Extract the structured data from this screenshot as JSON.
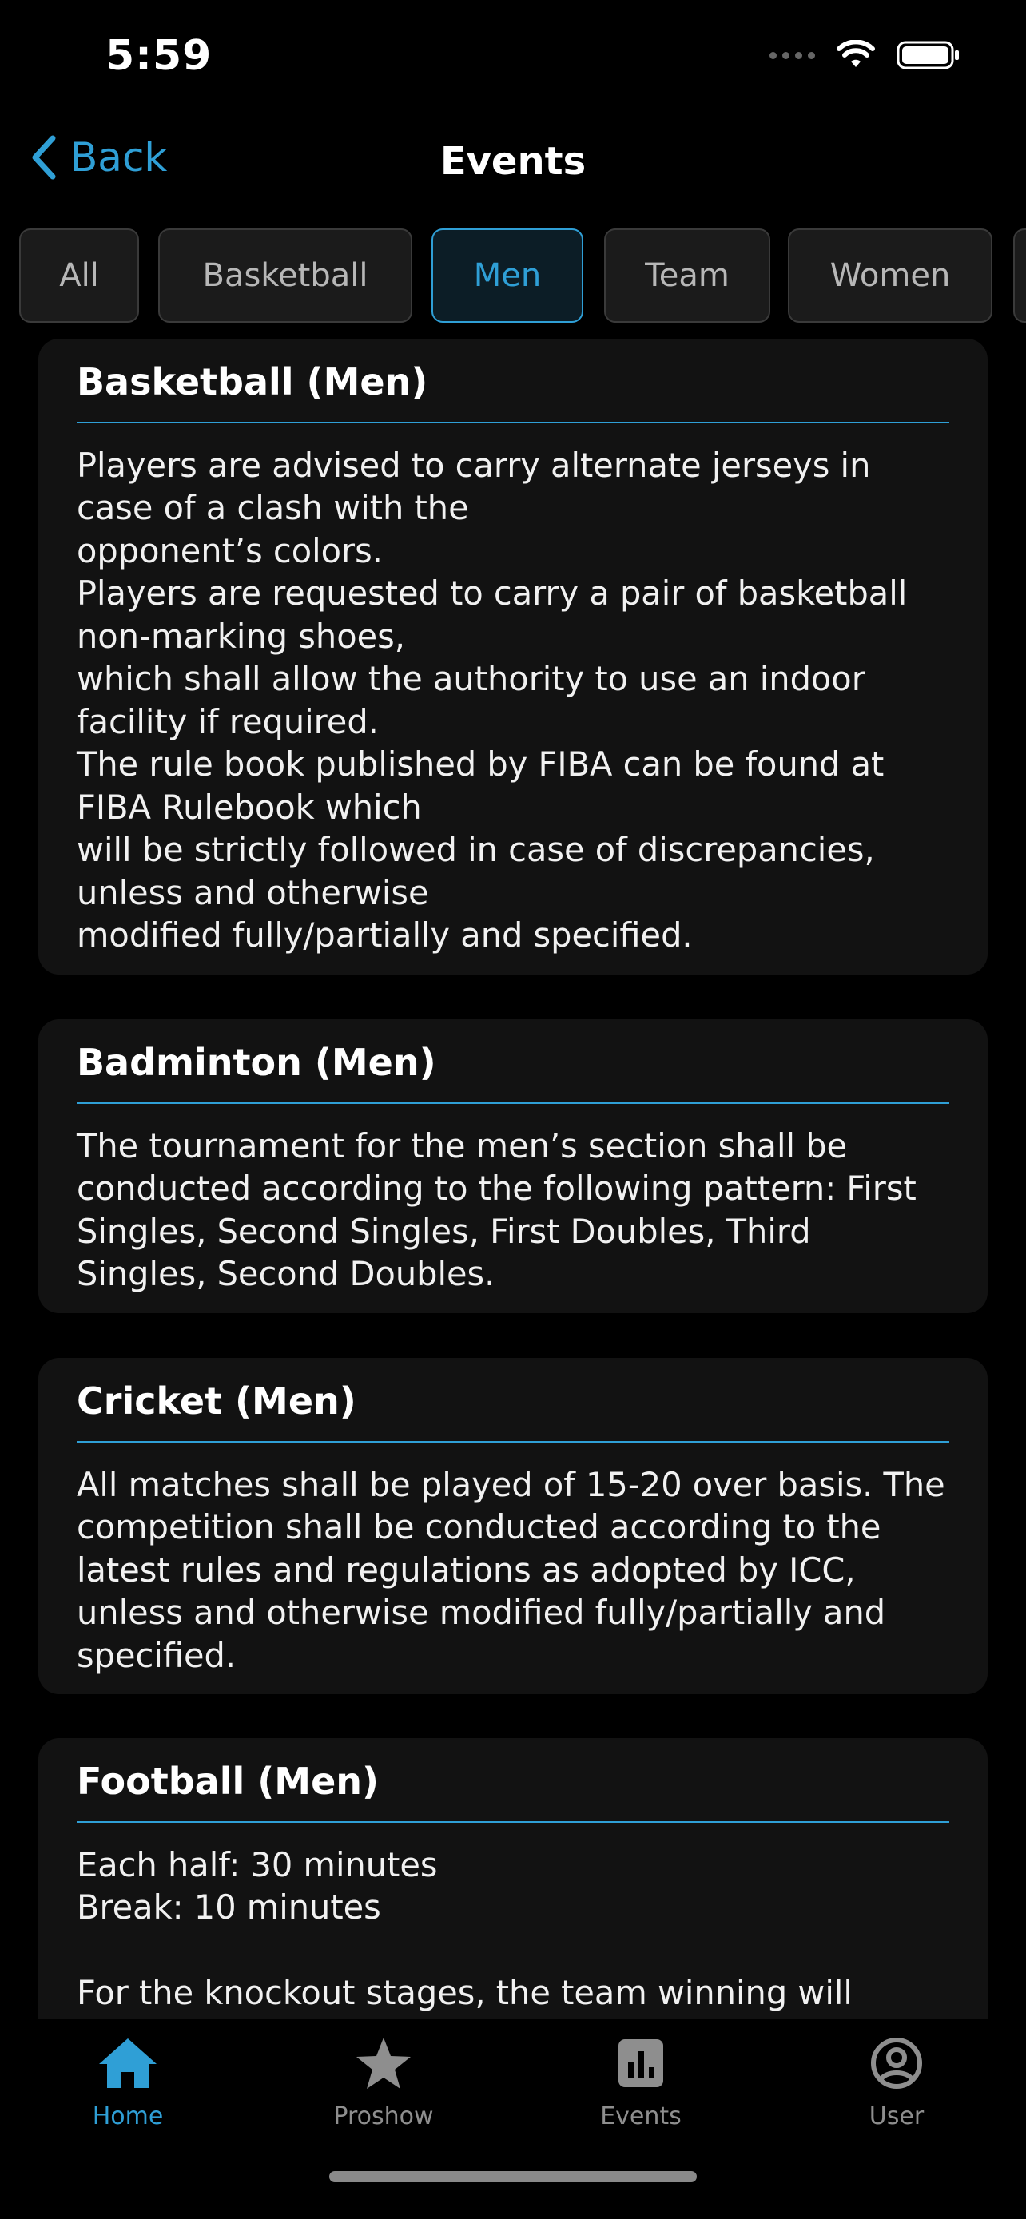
{
  "status_bar": {
    "time": "5:59"
  },
  "nav": {
    "back_label": "Back",
    "title": "Events"
  },
  "filters": {
    "items": [
      "All",
      "Basketball",
      "Men",
      "Team",
      "Women"
    ],
    "selected": "Men"
  },
  "events": [
    {
      "title": "Basketball (Men)",
      "body": "Players are advised to carry alternate jerseys in case of a clash with the\nopponent’s colors.\nPlayers are requested to carry a pair of basketball non-marking shoes,\nwhich shall allow the authority to use an indoor facility if required.\nThe rule book published by FIBA can be found at FIBA Rulebook which\nwill be strictly followed in case of discrepancies, unless and otherwise\nmodified fully/partially and specified."
    },
    {
      "title": "Badminton (Men)",
      "body": "The tournament for the men’s section shall be conducted according to the following pattern: First Singles, Second Singles, First Doubles, Third Singles, Second Doubles."
    },
    {
      "title": "Cricket (Men)",
      "body": "All matches shall be played of 15-20 over basis. The competition shall be conducted according to the latest rules and regulations as adopted by ICC, unless and otherwise modified fully/partially and specified."
    },
    {
      "title": "Football (Men)",
      "body": "Each half: 30 minutes\nBreak: 10 minutes\n\nFor the knockout stages, the team winning will"
    }
  ],
  "tabs": [
    {
      "label": "Home",
      "icon": "home-icon",
      "active": true
    },
    {
      "label": "Proshow",
      "icon": "star-icon",
      "active": false
    },
    {
      "label": "Events",
      "icon": "chart-icon",
      "active": false
    },
    {
      "label": "User",
      "icon": "user-icon",
      "active": false
    }
  ],
  "colors": {
    "accent": "#2f9fd6",
    "background": "#000000",
    "card": "#121212",
    "inactive": "#8e8e8e"
  }
}
